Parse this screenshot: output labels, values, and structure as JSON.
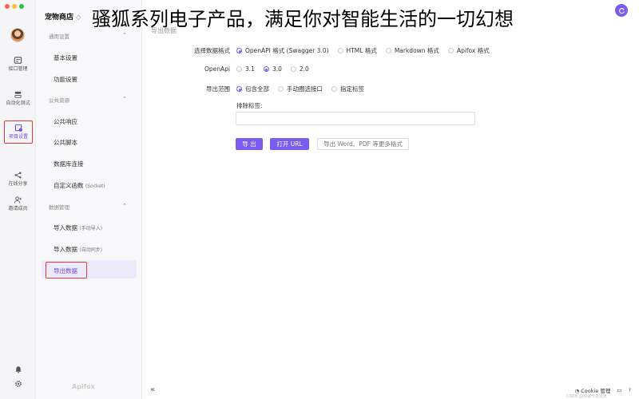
{
  "overlay_title": "骚狐系列电子产品，满足你对智能生活的一切幻想",
  "rail": {
    "items": [
      {
        "label": "接口管理",
        "icon": "api-icon"
      },
      {
        "label": "自动化测试",
        "icon": "test-icon"
      },
      {
        "label": "项目设置",
        "icon": "settings-icon"
      },
      {
        "label": "在线分享",
        "icon": "share-icon"
      },
      {
        "label": "邀请成员",
        "icon": "invite-icon"
      }
    ]
  },
  "sidebar": {
    "project": "宠物商店",
    "project_chevron": "◇",
    "sections": [
      {
        "title": "通用设置",
        "items": [
          {
            "label": "基本设置"
          },
          {
            "label": "功能设置"
          }
        ]
      },
      {
        "title": "公共资源",
        "items": [
          {
            "label": "公共响应"
          },
          {
            "label": "公共脚本"
          },
          {
            "label": "数据库连接"
          },
          {
            "label": "自定义函数",
            "note": "(Socket)"
          }
        ]
      },
      {
        "title": "数据管理",
        "items": [
          {
            "label": "导入数据",
            "note": "(手动导入)"
          },
          {
            "label": "导入数据",
            "note": "(自动同步)"
          },
          {
            "label": "导出数据"
          }
        ]
      }
    ],
    "logo_text": "Apifox"
  },
  "main": {
    "breadcrumb": "导出数据",
    "format_label": "选择数据格式",
    "formats": [
      "OpenAPI 格式 (Swagger 3.0)",
      "HTML 格式",
      "Markdown 格式",
      "Apifox 格式"
    ],
    "openapi_label": "OpenApi",
    "versions": [
      "3.1",
      "3.0",
      "2.0"
    ],
    "scope_label": "导出范围",
    "scopes": [
      "包含全部",
      "手动圈选接口",
      "指定标签"
    ],
    "exclude_label": "排除标签:",
    "exclude_value": "",
    "btn_export": "导 出",
    "btn_open_url": "打开 URL",
    "btn_more": "导出 Word、PDF 等更多格式"
  },
  "footer": {
    "cookie": "Cookie 管理",
    "watermark": "CSDN @测试开发技术"
  },
  "colors": {
    "accent": "#7b5cf0",
    "highlight_border": "#e53935"
  }
}
